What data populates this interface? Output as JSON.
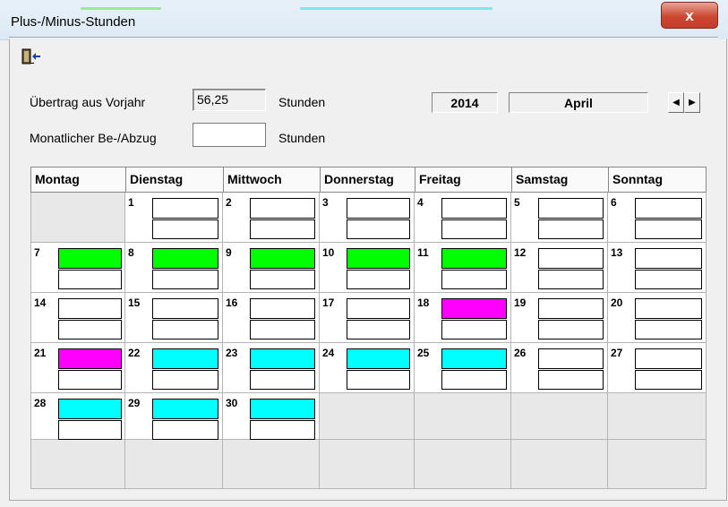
{
  "window": {
    "title": "Plus-/Minus-Stunden",
    "close_label": "x"
  },
  "toolbar": {
    "exit_icon": "exit-door-icon"
  },
  "form": {
    "carryover_label": "Übertrag aus Vorjahr",
    "carryover_value": "56,25",
    "carryover_unit": "Stunden",
    "monthly_label": "Monatlicher Be-/Abzug",
    "monthly_value": "",
    "monthly_unit": "Stunden",
    "year": "2014",
    "month": "April",
    "prev_label": "◀",
    "next_label": "▶"
  },
  "colors": {
    "green": "#00ff00",
    "magenta": "#ff00ff",
    "cyan": "#00ffff",
    "white": "#ffffff",
    "empty_cell": "#e8e8e8"
  },
  "calendar": {
    "weekdays": [
      "Montag",
      "Dienstag",
      "Mittwoch",
      "Donnerstag",
      "Freitag",
      "Samstag",
      "Sonntag"
    ],
    "weeks": [
      [
        null,
        {
          "day": "1",
          "mark": "white"
        },
        {
          "day": "2",
          "mark": "white"
        },
        {
          "day": "3",
          "mark": "white"
        },
        {
          "day": "4",
          "mark": "white"
        },
        {
          "day": "5",
          "mark": "white"
        },
        {
          "day": "6",
          "mark": "white"
        }
      ],
      [
        {
          "day": "7",
          "mark": "green"
        },
        {
          "day": "8",
          "mark": "green"
        },
        {
          "day": "9",
          "mark": "green"
        },
        {
          "day": "10",
          "mark": "green"
        },
        {
          "day": "11",
          "mark": "green"
        },
        {
          "day": "12",
          "mark": "white"
        },
        {
          "day": "13",
          "mark": "white"
        }
      ],
      [
        {
          "day": "14",
          "mark": "white"
        },
        {
          "day": "15",
          "mark": "white"
        },
        {
          "day": "16",
          "mark": "white"
        },
        {
          "day": "17",
          "mark": "white"
        },
        {
          "day": "18",
          "mark": "magenta"
        },
        {
          "day": "19",
          "mark": "white"
        },
        {
          "day": "20",
          "mark": "white"
        }
      ],
      [
        {
          "day": "21",
          "mark": "magenta"
        },
        {
          "day": "22",
          "mark": "cyan"
        },
        {
          "day": "23",
          "mark": "cyan"
        },
        {
          "day": "24",
          "mark": "cyan"
        },
        {
          "day": "25",
          "mark": "cyan"
        },
        {
          "day": "26",
          "mark": "white"
        },
        {
          "day": "27",
          "mark": "white"
        }
      ],
      [
        {
          "day": "28",
          "mark": "cyan"
        },
        {
          "day": "29",
          "mark": "cyan"
        },
        {
          "day": "30",
          "mark": "cyan"
        },
        null,
        null,
        null,
        null
      ],
      [
        null,
        null,
        null,
        null,
        null,
        null,
        null
      ]
    ]
  }
}
